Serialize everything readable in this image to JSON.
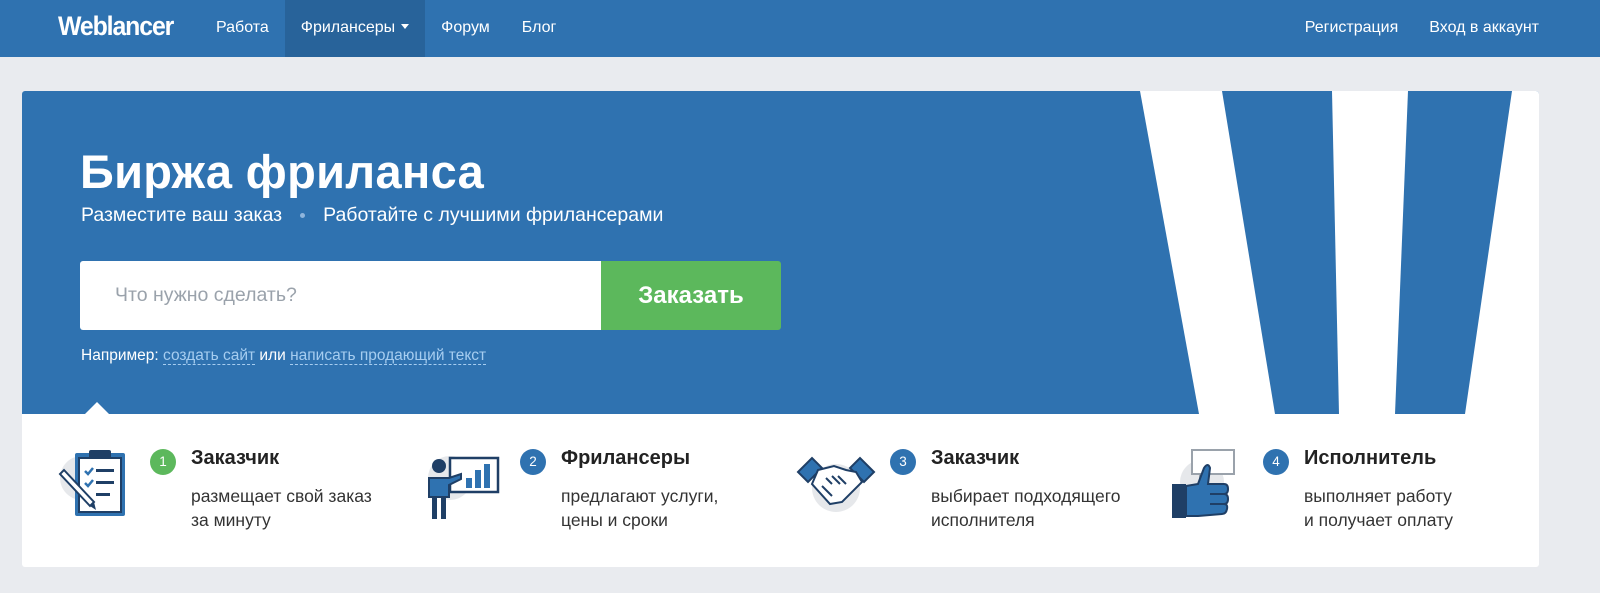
{
  "nav": {
    "logo": "Weblancer",
    "links": [
      "Работа",
      "Фрилансеры",
      "Форум",
      "Блог"
    ],
    "right": [
      "Регистрация",
      "Вход в аккаунт"
    ]
  },
  "hero": {
    "title": "Биржа фриланса",
    "subtitle_left": "Разместите ваш заказ",
    "subtitle_right": "Работайте с лучшими фрилансерами",
    "search_placeholder": "Что нужно сделать?",
    "order_button": "Заказать",
    "example_prefix": "Например:",
    "example_link1": "создать сайт",
    "example_or": "или",
    "example_link2": "написать продающий текст"
  },
  "steps": [
    {
      "num": "1",
      "title": "Заказчик",
      "line1": "размещает свой заказ",
      "line2": "за минуту",
      "icon": "clipboard-icon",
      "color": "#5cb85c"
    },
    {
      "num": "2",
      "title": "Фрилансеры",
      "line1": "предлагают услуги,",
      "line2": "цены и сроки",
      "icon": "presentation-icon",
      "color": "#2f72b0"
    },
    {
      "num": "3",
      "title": "Заказчик",
      "line1": "выбирает подходящего",
      "line2": "исполнителя",
      "icon": "handshake-icon",
      "color": "#2f72b0"
    },
    {
      "num": "4",
      "title": "Исполнитель",
      "line1": "выполняет работу",
      "line2": "и получает оплату",
      "icon": "thumbs-up-icon",
      "color": "#2f72b0"
    }
  ],
  "colors": {
    "brand_blue": "#2f72b0",
    "nav_active": "#28639a",
    "button_green": "#5cb85c",
    "link_blue": "#a6cdf0",
    "page_bg": "#e9ebef"
  }
}
